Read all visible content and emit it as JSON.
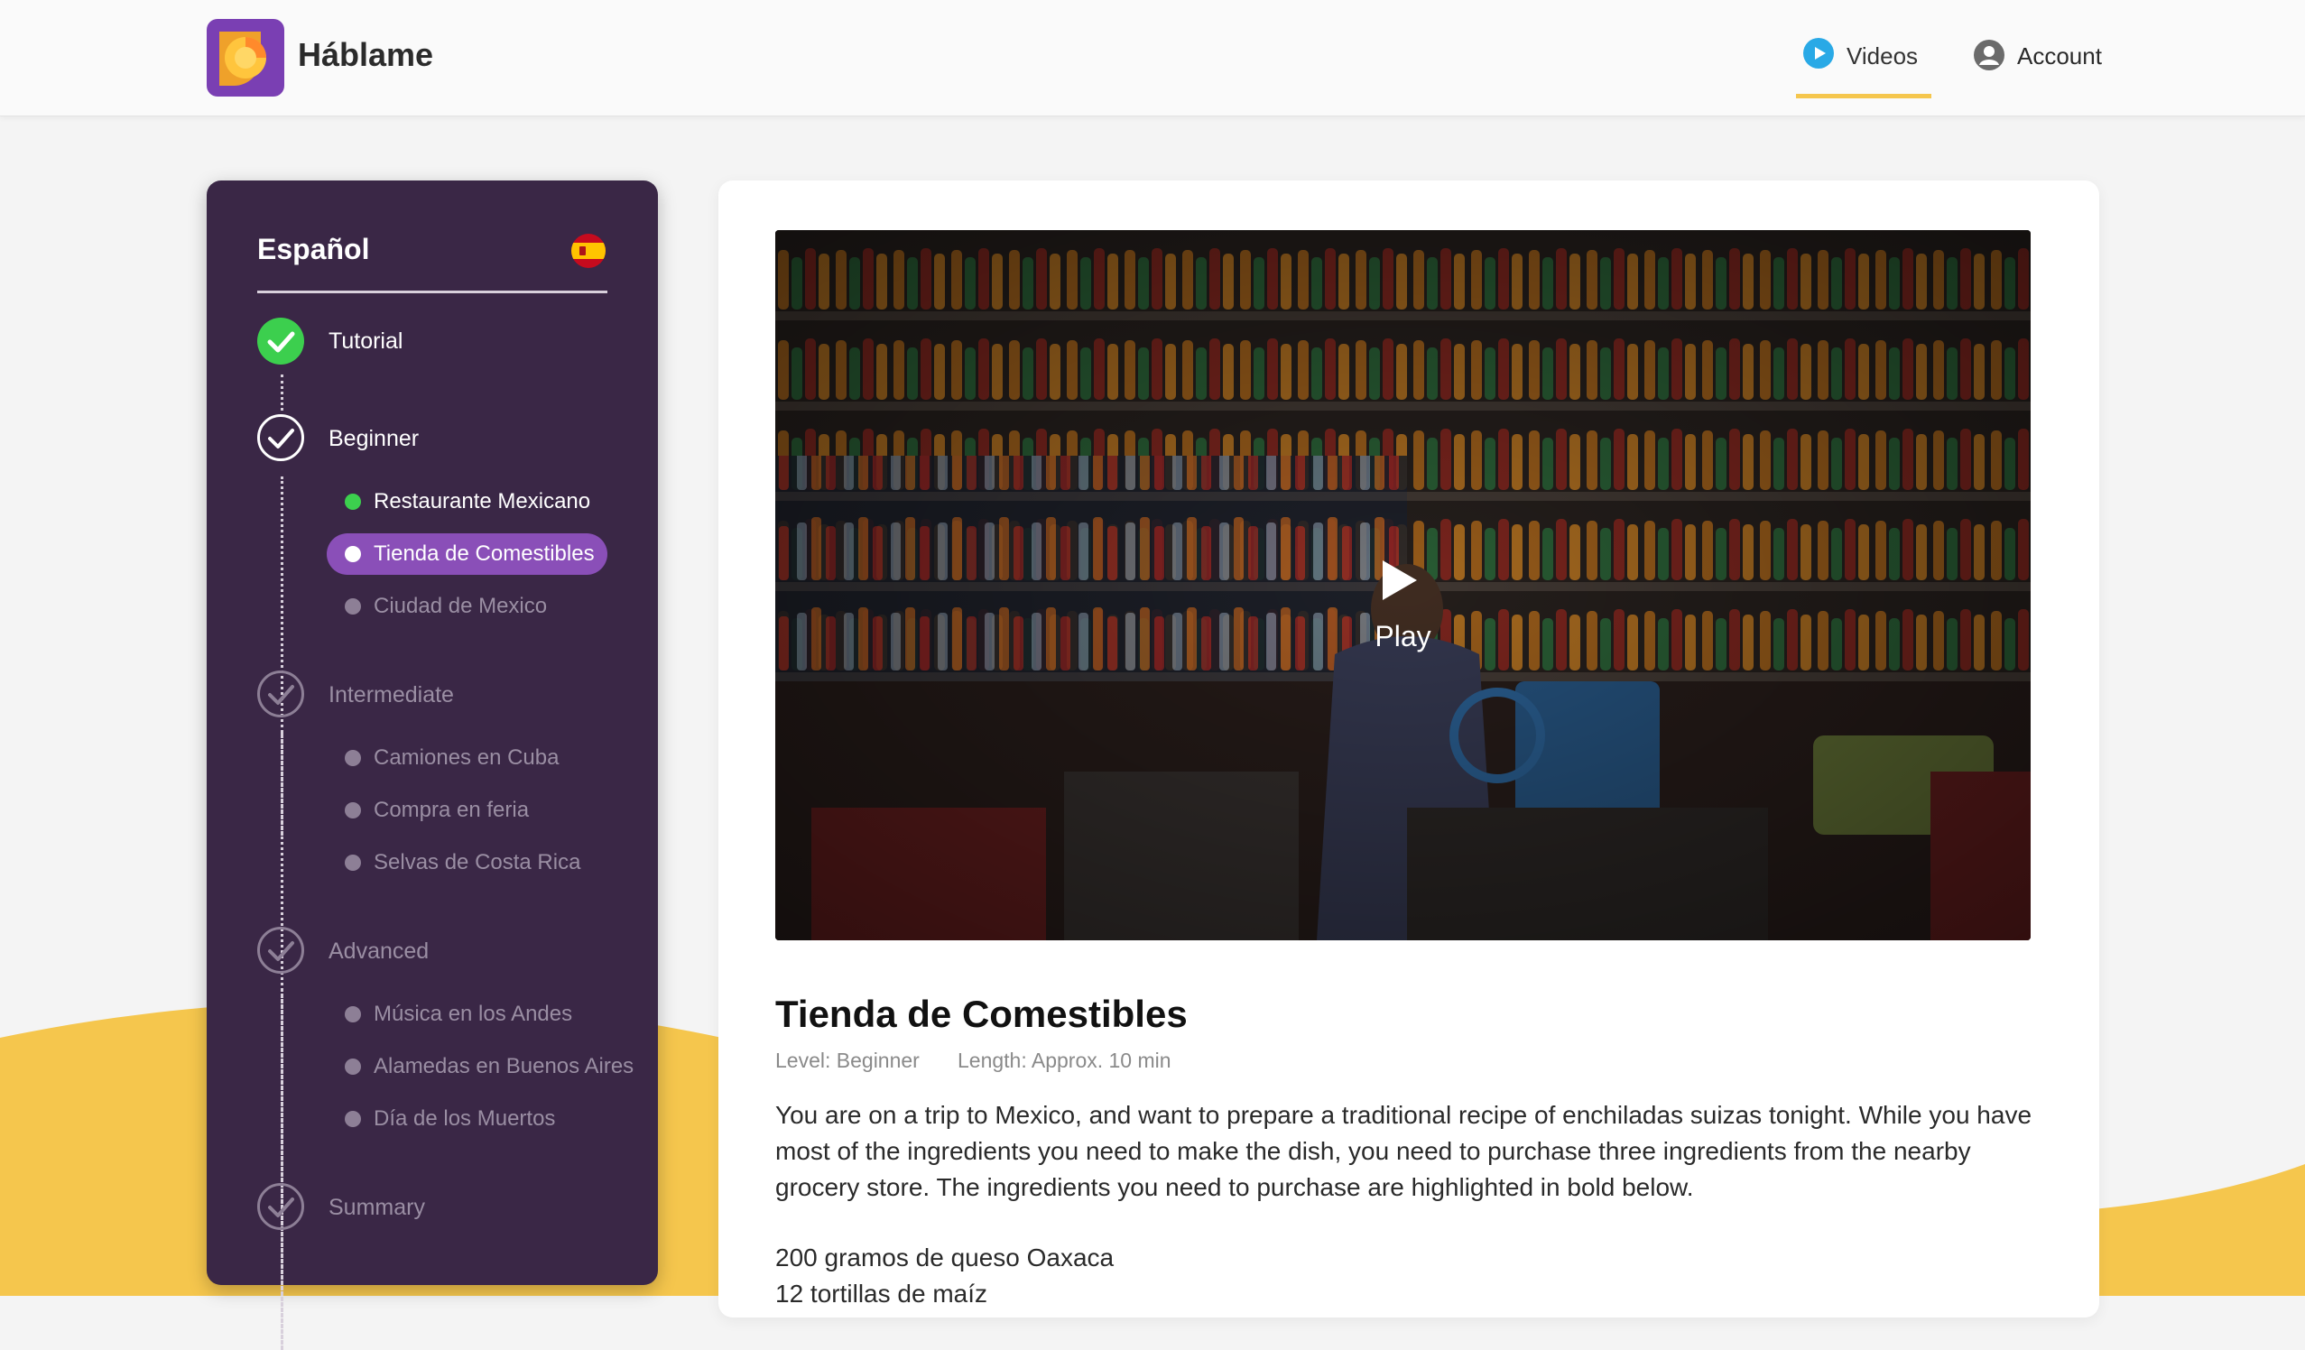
{
  "app": {
    "brand": "Háblame"
  },
  "nav": {
    "videos": "Videos",
    "account": "Account"
  },
  "colors": {
    "accent_yellow": "#f5c64d",
    "sidebar_bg": "#3a2746",
    "active_pill": "#8a4fb8",
    "complete_green": "#3ccf4e"
  },
  "sidebar": {
    "language": "Español",
    "flag_icon": "spain-flag-icon",
    "sections": [
      {
        "label": "Tutorial",
        "state": "complete"
      },
      {
        "label": "Beginner",
        "state": "in-progress",
        "items": [
          {
            "label": "Restaurante Mexicano",
            "state": "complete"
          },
          {
            "label": "Tienda de Comestibles",
            "state": "active"
          },
          {
            "label": "Ciudad de Mexico",
            "state": "locked"
          }
        ]
      },
      {
        "label": "Intermediate",
        "state": "locked",
        "items": [
          {
            "label": "Camiones en Cuba",
            "state": "locked"
          },
          {
            "label": "Compra en feria",
            "state": "locked"
          },
          {
            "label": "Selvas de Costa Rica",
            "state": "locked"
          }
        ]
      },
      {
        "label": "Advanced",
        "state": "locked",
        "items": [
          {
            "label": "Música en los Andes",
            "state": "locked"
          },
          {
            "label": "Alamedas en Buenos Aires",
            "state": "locked"
          },
          {
            "label": "Día de los Muertos",
            "state": "locked"
          }
        ]
      },
      {
        "label": "Summary",
        "state": "locked"
      }
    ]
  },
  "main": {
    "video": {
      "play_label": "Play"
    },
    "title": "Tienda de Comestibles",
    "level": "Level: Beginner",
    "length": "Length: Approx. 10 min",
    "description": "You are on a trip to Mexico, and want to prepare a traditional  recipe of enchiladas suizas tonight. While you have most of the ingredients you need to make the dish, you need to purchase three ingredients from the nearby grocery store. The ingredients you need to purchase are highlighted in bold below.",
    "ingredients": [
      "200 gramos de queso Oaxaca",
      "12 tortillas de maíz"
    ]
  }
}
